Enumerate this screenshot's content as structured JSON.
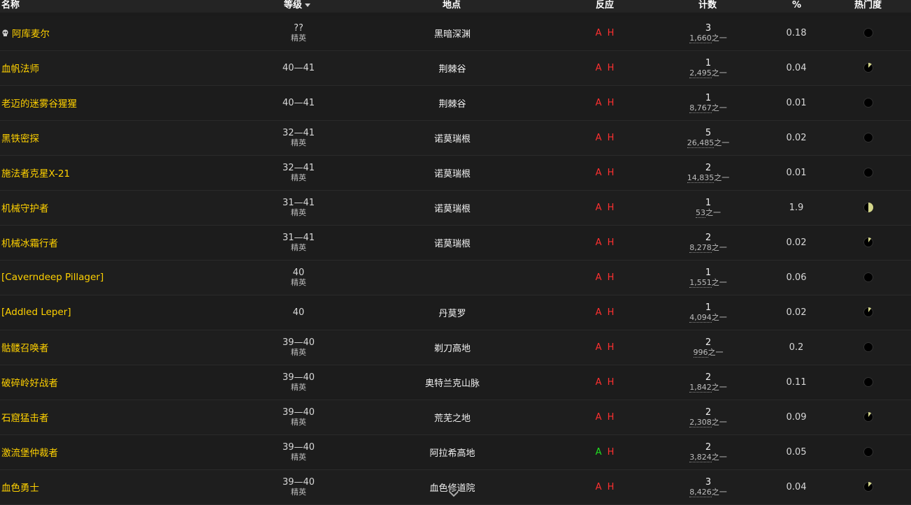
{
  "header": {
    "name": "名称",
    "level": "等级",
    "zone": "地点",
    "react": "反应",
    "count": "计数",
    "pct": "%",
    "popularity": "热门度"
  },
  "colors": {
    "name": "#ffd100",
    "hostile": "#ff3030",
    "friendly": "#20e020",
    "pie_fill": "#d4d68a"
  },
  "rows": [
    {
      "name": "阿库麦尔",
      "skull": true,
      "level": "??",
      "elite": "精英",
      "zone": "黑暗深渊",
      "react_a": "A",
      "react_h": "H",
      "a_friendly": false,
      "count": "3",
      "of_num": "1,660",
      "of_suffix": "之一",
      "pct": "0.18",
      "pop": 0.0
    },
    {
      "name": "血帆法师",
      "skull": false,
      "level": "40—41",
      "elite": "",
      "zone": "荆棘谷",
      "react_a": "A",
      "react_h": "H",
      "a_friendly": false,
      "count": "1",
      "of_num": "2,495",
      "of_suffix": "之一",
      "pct": "0.04",
      "pop": 0.12
    },
    {
      "name": "老迈的迷雾谷猩猩",
      "skull": false,
      "level": "40—41",
      "elite": "",
      "zone": "荆棘谷",
      "react_a": "A",
      "react_h": "H",
      "a_friendly": false,
      "count": "1",
      "of_num": "8,767",
      "of_suffix": "之一",
      "pct": "0.01",
      "pop": 0.0
    },
    {
      "name": "黑铁密探",
      "skull": false,
      "level": "32—41",
      "elite": "精英",
      "zone": "诺莫瑞根",
      "react_a": "A",
      "react_h": "H",
      "a_friendly": false,
      "count": "5",
      "of_num": "26,485",
      "of_suffix": "之一",
      "pct": "0.02",
      "pop": 0.0
    },
    {
      "name": "施法者克星X-21",
      "skull": false,
      "level": "32—41",
      "elite": "精英",
      "zone": "诺莫瑞根",
      "react_a": "A",
      "react_h": "H",
      "a_friendly": false,
      "count": "2",
      "of_num": "14,835",
      "of_suffix": "之一",
      "pct": "0.01",
      "pop": 0.0
    },
    {
      "name": "机械守护者",
      "skull": false,
      "level": "31—41",
      "elite": "精英",
      "zone": "诺莫瑞根",
      "react_a": "A",
      "react_h": "H",
      "a_friendly": false,
      "count": "1",
      "of_num": "53",
      "of_suffix": "之一",
      "pct": "1.9",
      "pop": 0.5
    },
    {
      "name": "机械冰霜行者",
      "skull": false,
      "level": "31—41",
      "elite": "精英",
      "zone": "诺莫瑞根",
      "react_a": "A",
      "react_h": "H",
      "a_friendly": false,
      "count": "2",
      "of_num": "8,278",
      "of_suffix": "之一",
      "pct": "0.02",
      "pop": 0.1
    },
    {
      "name": "[Caverndeep Pillager]",
      "skull": false,
      "level": "40",
      "elite": "精英",
      "zone": "",
      "react_a": "A",
      "react_h": "H",
      "a_friendly": false,
      "count": "1",
      "of_num": "1,551",
      "of_suffix": "之一",
      "pct": "0.06",
      "pop": 0.0
    },
    {
      "name": "[Addled Leper]",
      "skull": false,
      "level": "40",
      "elite": "",
      "zone": "丹莫罗",
      "react_a": "A",
      "react_h": "H",
      "a_friendly": false,
      "count": "1",
      "of_num": "4,094",
      "of_suffix": "之一",
      "pct": "0.02",
      "pop": 0.1
    },
    {
      "name": "骷髅召唤者",
      "skull": false,
      "level": "39—40",
      "elite": "精英",
      "zone": "剃刀高地",
      "react_a": "A",
      "react_h": "H",
      "a_friendly": false,
      "count": "2",
      "of_num": "996",
      "of_suffix": "之一",
      "pct": "0.2",
      "pop": 0.0
    },
    {
      "name": "破碎岭好战者",
      "skull": false,
      "level": "39—40",
      "elite": "精英",
      "zone": "奥特兰克山脉",
      "react_a": "A",
      "react_h": "H",
      "a_friendly": false,
      "count": "2",
      "of_num": "1,842",
      "of_suffix": "之一",
      "pct": "0.11",
      "pop": 0.0
    },
    {
      "name": "石窟猛击者",
      "skull": false,
      "level": "39—40",
      "elite": "精英",
      "zone": "荒芜之地",
      "react_a": "A",
      "react_h": "H",
      "a_friendly": false,
      "count": "2",
      "of_num": "2,308",
      "of_suffix": "之一",
      "pct": "0.09",
      "pop": 0.1
    },
    {
      "name": "激流堡仲裁者",
      "skull": false,
      "level": "39—40",
      "elite": "精英",
      "zone": "阿拉希高地",
      "react_a": "A",
      "react_h": "H",
      "a_friendly": true,
      "count": "2",
      "of_num": "3,824",
      "of_suffix": "之一",
      "pct": "0.05",
      "pop": 0.0
    },
    {
      "name": "血色勇士",
      "skull": false,
      "level": "39—40",
      "elite": "精英",
      "zone": "血色修道院",
      "react_a": "A",
      "react_h": "H",
      "a_friendly": false,
      "count": "3",
      "of_num": "8,426",
      "of_suffix": "之一",
      "pct": "0.04",
      "pop": 0.12
    }
  ]
}
